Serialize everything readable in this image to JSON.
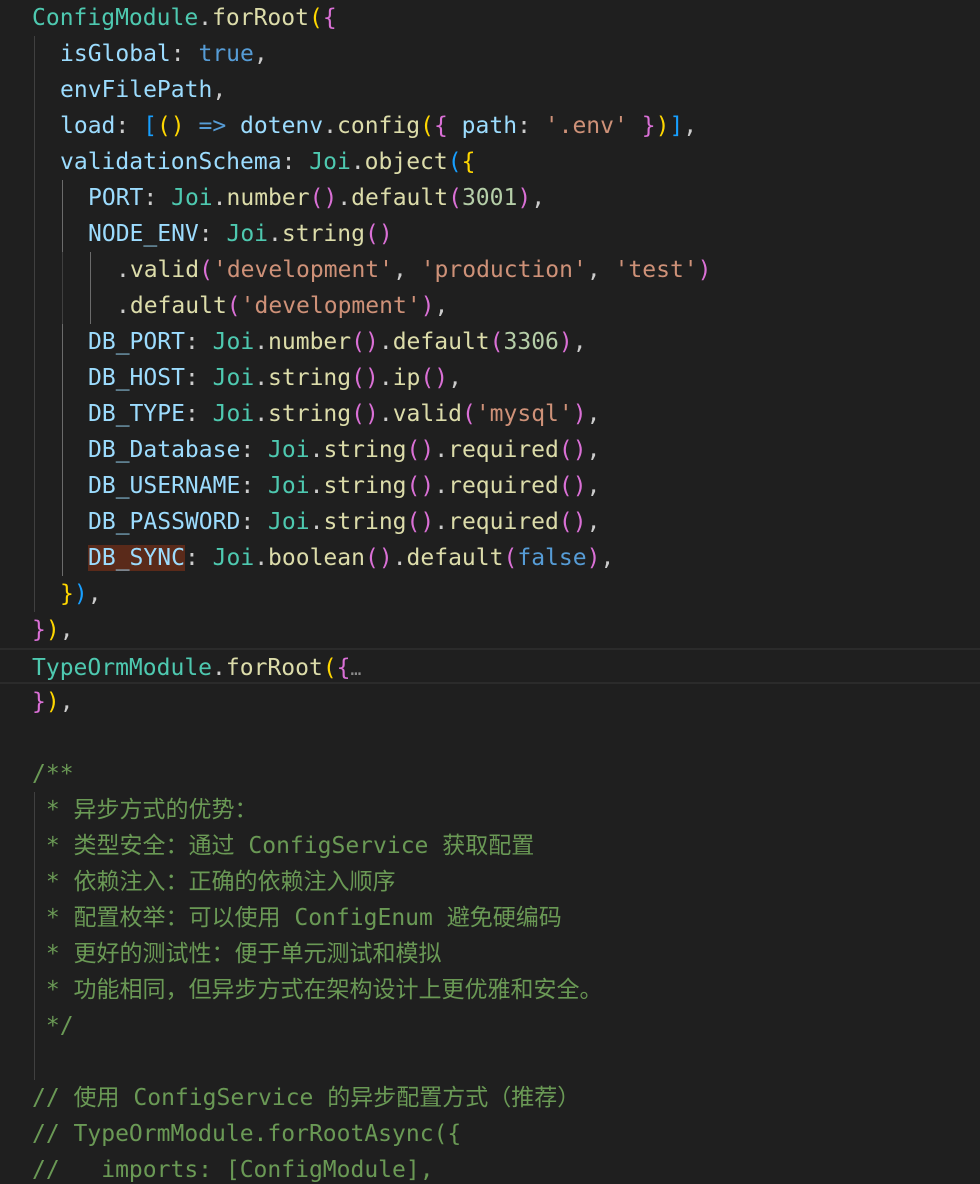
{
  "editor": {
    "language": "typescript",
    "folded_placeholder": "…",
    "lines": [
      {
        "tokens": [
          [
            "ConfigModule",
            "cls"
          ],
          [
            ".",
            "pun"
          ],
          [
            "forRoot",
            "fn"
          ],
          [
            "(",
            "b1"
          ],
          [
            "{",
            "b2"
          ]
        ]
      },
      {
        "tokens": [
          [
            "isGlobal",
            "prop"
          ],
          [
            ": ",
            "pun"
          ],
          [
            "true",
            "kw"
          ],
          [
            ",",
            "pun"
          ]
        ]
      },
      {
        "tokens": [
          [
            "envFilePath",
            "prop"
          ],
          [
            ",",
            "pun"
          ]
        ]
      },
      {
        "tokens": [
          [
            "load",
            "prop"
          ],
          [
            ": ",
            "pun"
          ],
          [
            "[",
            "b3"
          ],
          [
            "()",
            "b1"
          ],
          [
            " => ",
            "kw"
          ],
          [
            "dotenv",
            "var"
          ],
          [
            ".",
            "pun"
          ],
          [
            "config",
            "fn"
          ],
          [
            "(",
            "b1"
          ],
          [
            "{",
            "b2"
          ],
          [
            " path",
            "prop"
          ],
          [
            ": ",
            "pun"
          ],
          [
            "'.env'",
            "str"
          ],
          [
            " ",
            "pun"
          ],
          [
            "}",
            "b2"
          ],
          [
            ")",
            "b1"
          ],
          [
            "]",
            "b3"
          ],
          [
            ",",
            "pun"
          ]
        ]
      },
      {
        "tokens": [
          [
            "validationSchema",
            "prop"
          ],
          [
            ": ",
            "pun"
          ],
          [
            "Joi",
            "cls"
          ],
          [
            ".",
            "pun"
          ],
          [
            "object",
            "fn"
          ],
          [
            "(",
            "b3"
          ],
          [
            "{",
            "b1"
          ]
        ]
      },
      {
        "tokens": [
          [
            "PORT",
            "prop"
          ],
          [
            ": ",
            "pun"
          ],
          [
            "Joi",
            "cls"
          ],
          [
            ".",
            "pun"
          ],
          [
            "number",
            "fn"
          ],
          [
            "()",
            "b2"
          ],
          [
            ".",
            "pun"
          ],
          [
            "default",
            "fn"
          ],
          [
            "(",
            "b2"
          ],
          [
            "3001",
            "num"
          ],
          [
            ")",
            "b2"
          ],
          [
            ",",
            "pun"
          ]
        ]
      },
      {
        "tokens": [
          [
            "NODE_ENV",
            "prop"
          ],
          [
            ": ",
            "pun"
          ],
          [
            "Joi",
            "cls"
          ],
          [
            ".",
            "pun"
          ],
          [
            "string",
            "fn"
          ],
          [
            "()",
            "b2"
          ]
        ]
      },
      {
        "tokens": [
          [
            ".",
            "pun"
          ],
          [
            "valid",
            "fn"
          ],
          [
            "(",
            "b2"
          ],
          [
            "'development'",
            "str"
          ],
          [
            ", ",
            "pun"
          ],
          [
            "'production'",
            "str"
          ],
          [
            ", ",
            "pun"
          ],
          [
            "'test'",
            "str"
          ],
          [
            ")",
            "b2"
          ]
        ]
      },
      {
        "tokens": [
          [
            ".",
            "pun"
          ],
          [
            "default",
            "fn"
          ],
          [
            "(",
            "b2"
          ],
          [
            "'development'",
            "str"
          ],
          [
            ")",
            "b2"
          ],
          [
            ",",
            "pun"
          ]
        ]
      },
      {
        "tokens": [
          [
            "DB_PORT",
            "prop"
          ],
          [
            ": ",
            "pun"
          ],
          [
            "Joi",
            "cls"
          ],
          [
            ".",
            "pun"
          ],
          [
            "number",
            "fn"
          ],
          [
            "()",
            "b2"
          ],
          [
            ".",
            "pun"
          ],
          [
            "default",
            "fn"
          ],
          [
            "(",
            "b2"
          ],
          [
            "3306",
            "num"
          ],
          [
            ")",
            "b2"
          ],
          [
            ",",
            "pun"
          ]
        ]
      },
      {
        "tokens": [
          [
            "DB_HOST",
            "prop"
          ],
          [
            ": ",
            "pun"
          ],
          [
            "Joi",
            "cls"
          ],
          [
            ".",
            "pun"
          ],
          [
            "string",
            "fn"
          ],
          [
            "()",
            "b2"
          ],
          [
            ".",
            "pun"
          ],
          [
            "ip",
            "fn"
          ],
          [
            "()",
            "b2"
          ],
          [
            ",",
            "pun"
          ]
        ]
      },
      {
        "tokens": [
          [
            "DB_TYPE",
            "prop"
          ],
          [
            ": ",
            "pun"
          ],
          [
            "Joi",
            "cls"
          ],
          [
            ".",
            "pun"
          ],
          [
            "string",
            "fn"
          ],
          [
            "()",
            "b2"
          ],
          [
            ".",
            "pun"
          ],
          [
            "valid",
            "fn"
          ],
          [
            "(",
            "b2"
          ],
          [
            "'mysql'",
            "str"
          ],
          [
            ")",
            "b2"
          ],
          [
            ",",
            "pun"
          ]
        ]
      },
      {
        "tokens": [
          [
            "DB_Database",
            "prop"
          ],
          [
            ": ",
            "pun"
          ],
          [
            "Joi",
            "cls"
          ],
          [
            ".",
            "pun"
          ],
          [
            "string",
            "fn"
          ],
          [
            "()",
            "b2"
          ],
          [
            ".",
            "pun"
          ],
          [
            "required",
            "fn"
          ],
          [
            "()",
            "b2"
          ],
          [
            ",",
            "pun"
          ]
        ]
      },
      {
        "tokens": [
          [
            "DB_USERNAME",
            "prop"
          ],
          [
            ": ",
            "pun"
          ],
          [
            "Joi",
            "cls"
          ],
          [
            ".",
            "pun"
          ],
          [
            "string",
            "fn"
          ],
          [
            "()",
            "b2"
          ],
          [
            ".",
            "pun"
          ],
          [
            "required",
            "fn"
          ],
          [
            "()",
            "b2"
          ],
          [
            ",",
            "pun"
          ]
        ]
      },
      {
        "tokens": [
          [
            "DB_PASSWORD",
            "prop"
          ],
          [
            ": ",
            "pun"
          ],
          [
            "Joi",
            "cls"
          ],
          [
            ".",
            "pun"
          ],
          [
            "string",
            "fn"
          ],
          [
            "()",
            "b2"
          ],
          [
            ".",
            "pun"
          ],
          [
            "required",
            "fn"
          ],
          [
            "()",
            "b2"
          ],
          [
            ",",
            "pun"
          ]
        ]
      },
      {
        "tokens": [
          [
            "DB_SYNC",
            "prop hl"
          ],
          [
            ": ",
            "pun"
          ],
          [
            "Joi",
            "cls"
          ],
          [
            ".",
            "pun"
          ],
          [
            "boolean",
            "fn"
          ],
          [
            "()",
            "b2"
          ],
          [
            ".",
            "pun"
          ],
          [
            "default",
            "fn"
          ],
          [
            "(",
            "b2"
          ],
          [
            "false",
            "kw"
          ],
          [
            ")",
            "b2"
          ],
          [
            ",",
            "pun"
          ]
        ]
      },
      {
        "tokens": [
          [
            "}",
            "b1"
          ],
          [
            ")",
            "b3"
          ],
          [
            ",",
            "pun"
          ]
        ]
      },
      {
        "tokens": [
          [
            "}",
            "b2"
          ],
          [
            ")",
            "b1"
          ],
          [
            ",",
            "pun"
          ]
        ]
      },
      {
        "tokens": [
          [
            "TypeOrmModule",
            "cls"
          ],
          [
            ".",
            "pun"
          ],
          [
            "forRoot",
            "fn"
          ],
          [
            "(",
            "b1"
          ],
          [
            "{",
            "b2"
          ]
        ],
        "folded": true
      },
      {
        "tokens": [
          [
            "}",
            "b2"
          ],
          [
            ")",
            "b1"
          ],
          [
            ",",
            "pun"
          ]
        ]
      },
      {
        "tokens": []
      },
      {
        "tokens": [
          [
            "/**",
            "cm"
          ]
        ]
      },
      {
        "tokens": [
          [
            " * 异步方式的优势：",
            "cm"
          ]
        ]
      },
      {
        "tokens": [
          [
            " * 类型安全：通过 ConfigService 获取配置",
            "cm"
          ]
        ]
      },
      {
        "tokens": [
          [
            " * 依赖注入：正确的依赖注入顺序",
            "cm"
          ]
        ]
      },
      {
        "tokens": [
          [
            " * 配置枚举：可以使用 ConfigEnum 避免硬编码",
            "cm"
          ]
        ]
      },
      {
        "tokens": [
          [
            " * 更好的测试性：便于单元测试和模拟",
            "cm"
          ]
        ]
      },
      {
        "tokens": [
          [
            " * 功能相同，但异步方式在架构设计上更优雅和安全。",
            "cm"
          ]
        ]
      },
      {
        "tokens": [
          [
            " */",
            "cm"
          ]
        ]
      },
      {
        "tokens": []
      },
      {
        "tokens": [
          [
            "// 使用 ConfigService 的异步配置方式（推荐）",
            "cm"
          ]
        ]
      },
      {
        "tokens": [
          [
            "// TypeOrmModule.forRootAsync({",
            "cm"
          ]
        ]
      },
      {
        "tokens": [
          [
            "//   imports: [ConfigModule],",
            "cm"
          ]
        ]
      }
    ]
  }
}
